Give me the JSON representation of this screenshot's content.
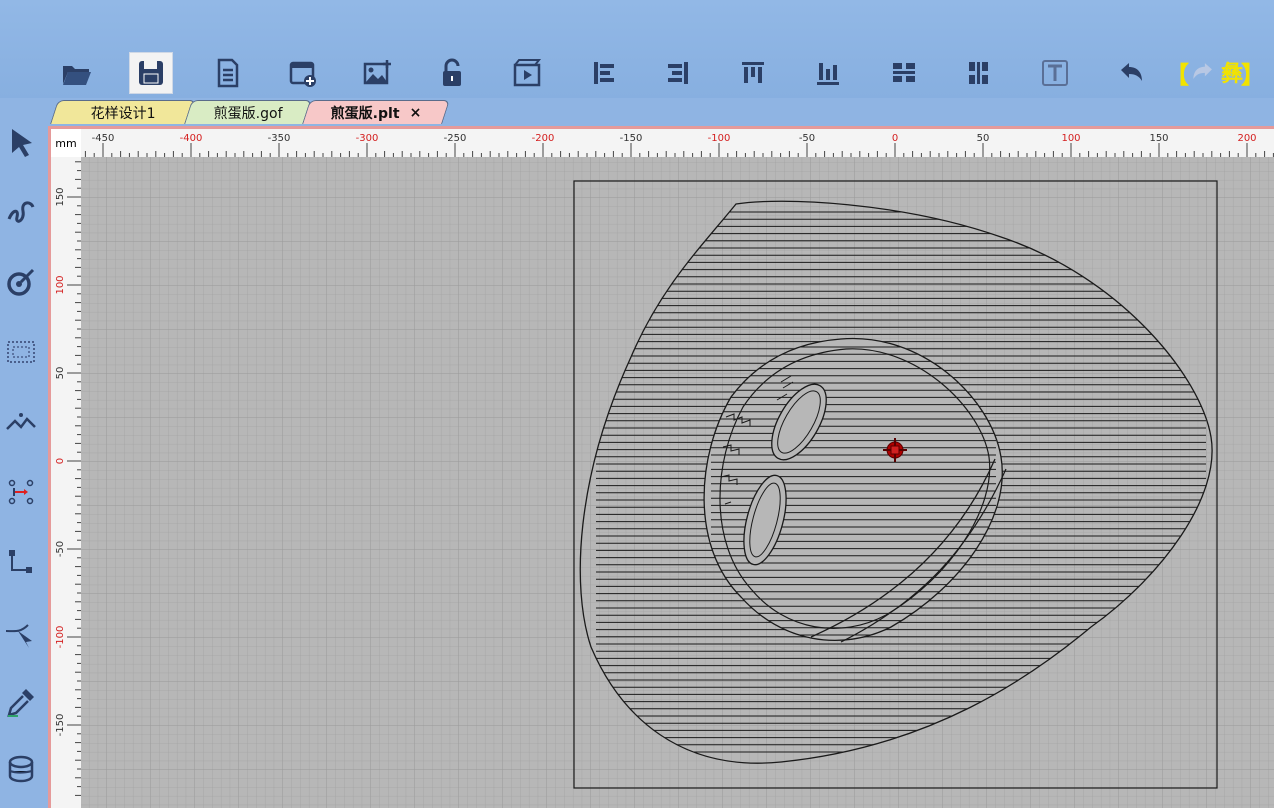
{
  "tabs": [
    {
      "label": "花样设计1"
    },
    {
      "label": "煎蛋版.gof"
    },
    {
      "label": "煎蛋版.plt",
      "close": "×"
    }
  ],
  "toolbar": {
    "icons": [
      "folder-open-icon",
      "save-icon",
      "document-list-icon",
      "new-window-icon",
      "insert-image-icon",
      "unlock-icon",
      "clapper-play-icon",
      "align-left-icon",
      "align-right-icon",
      "align-top-icon",
      "align-bottom-icon",
      "distribute-horizontal-icon",
      "distribute-vertical-icon",
      "text-icon",
      "undo-icon",
      "redo-icon"
    ],
    "bracket_text": "【",
    "bracket_text2": "】",
    "mid_glyph": "彝",
    "accent_yellow": "#f2e300"
  },
  "ruler": {
    "unit": "mm",
    "top_labels": [
      -450,
      -400,
      -350,
      -300,
      -250,
      -200,
      -150,
      -100,
      -50,
      0,
      50,
      100,
      150,
      200
    ],
    "left_labels": [
      150,
      100,
      50,
      0,
      -50,
      -100,
      -150
    ],
    "red_color": "#d42020"
  },
  "sidebar": {
    "icons": [
      "select-arrow-icon",
      "freehand-curve-icon",
      "node-edit-icon",
      "dotted-rectangle-icon",
      "polyline-icon",
      "transform-points-icon",
      "connect-nodes-icon",
      "cut-icon",
      "eyedropper-icon",
      "fill-bucket-icon"
    ]
  },
  "colors": {
    "grid_bg": "#b7b7b7",
    "grid_line": "#9f9f9f",
    "drawing": "#1a1a1a",
    "marker": "#b00000"
  }
}
